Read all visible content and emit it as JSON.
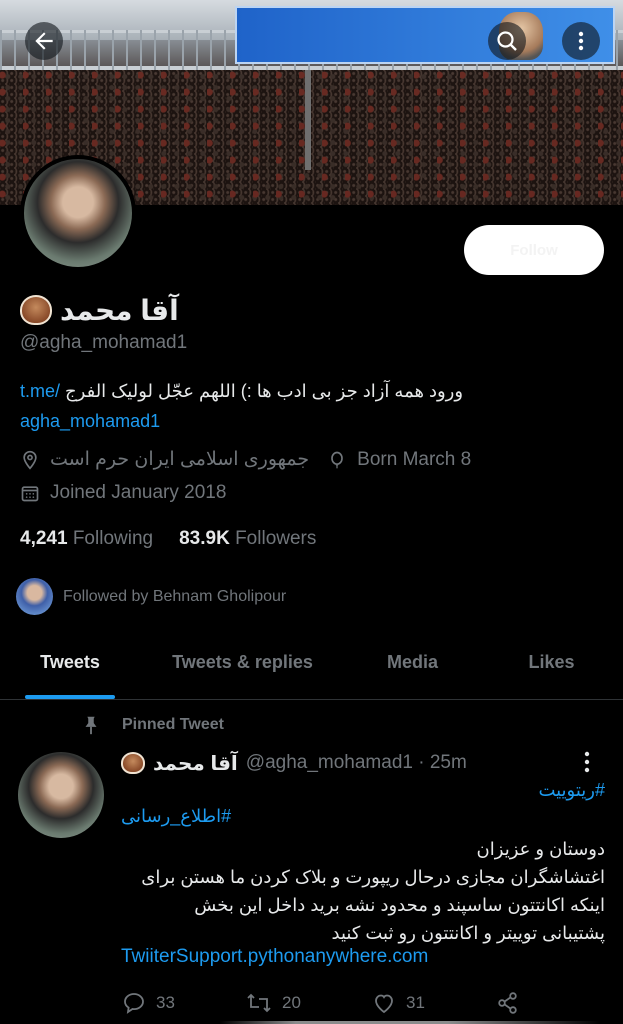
{
  "header": {
    "back_icon": "arrow-left-icon",
    "search_icon": "search-icon",
    "more_icon": "more-vertical-icon"
  },
  "profile": {
    "display_name": "آقا محمد",
    "handle": "@agha_mohamad1",
    "follow_label": "Follow",
    "bio_text": "ورود همه آزاد جز بی ادب ها :)  اللهم عجّل لولیک الفرج",
    "bio_link_part1": "t.me/",
    "bio_link_part2": "agha_mohamad1",
    "location": "جمهوری اسلامی ایران حرم است",
    "born": "Born March 8",
    "joined": "Joined January 2018",
    "following_count": "4,241",
    "following_label": "Following",
    "followers_count": "83.9K",
    "followers_label": "Followers",
    "followed_by": "Followed by Behnam Gholipour"
  },
  "tabs": [
    {
      "label": "Tweets",
      "active": true
    },
    {
      "label": "Tweets & replies",
      "active": false
    },
    {
      "label": "Media",
      "active": false
    },
    {
      "label": "Likes",
      "active": false
    }
  ],
  "tweet": {
    "pinned_label": "Pinned Tweet",
    "name": "آقا محمد",
    "handle_time": "@agha_mohamad1 · 25m",
    "hashtag1": "#ریتوییت",
    "hashtag2": "#اطلاع_رسانی",
    "body_lines": [
      "دوستان و عزیزان",
      "اغتشاشگران مجازی درحال ریپورت و بلاک کردن ما هستن برای",
      "اینکه اکانتتون ساسپند و محدود نشه برید داخل این بخش",
      "پشتیبانی توییتر و اکانتتون رو ثبت کنید"
    ],
    "link": "TwiiterSupport.pythonanywhere.com",
    "replies": "33",
    "retweets": "20",
    "likes": "31"
  },
  "colors": {
    "accent": "#1d9bf0",
    "muted": "#71767b",
    "text": "#e7e9ea",
    "background": "#000000"
  }
}
